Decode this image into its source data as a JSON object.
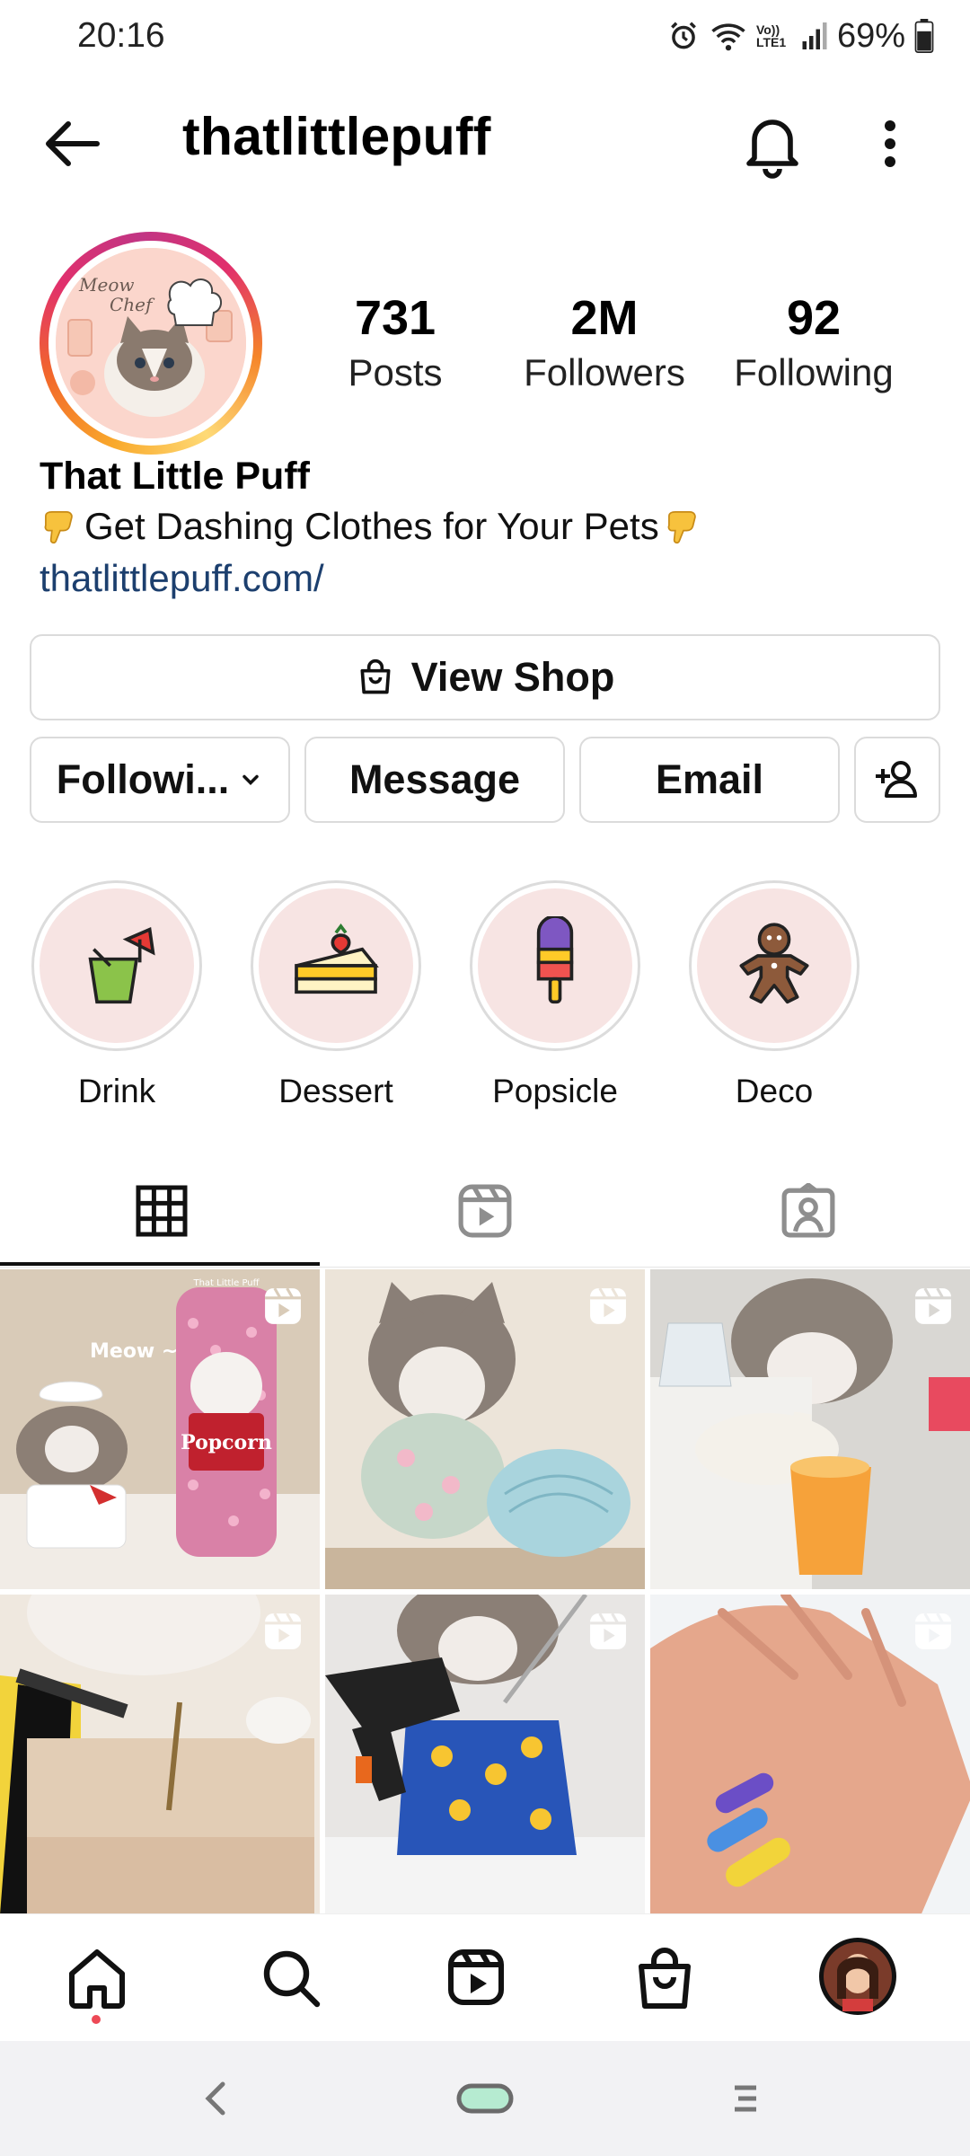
{
  "status": {
    "time": "20:16",
    "battery": "69%",
    "network_badge": "Vo)) LTE1"
  },
  "header": {
    "username": "thatlittlepuff"
  },
  "profile": {
    "avatar_text": "Meow Chef",
    "stats": [
      {
        "num": "731",
        "label": "Posts"
      },
      {
        "num": "2M",
        "label": "Followers"
      },
      {
        "num": "92",
        "label": "Following"
      }
    ],
    "display_name": "That Little Puff",
    "bio": "Get Dashing Clothes for Your Pets",
    "link": "thatlittlepuff.com/"
  },
  "buttons": {
    "view_shop": "View Shop",
    "following": "Followi...",
    "message": "Message",
    "email": "Email"
  },
  "highlights": [
    {
      "label": "Drink",
      "icon": "drink-icon"
    },
    {
      "label": "Dessert",
      "icon": "cake-icon"
    },
    {
      "label": "Popsicle",
      "icon": "popsicle-icon"
    },
    {
      "label": "Deco",
      "icon": "gingerbread-icon"
    }
  ],
  "tabs": [
    {
      "name": "grid-icon",
      "active": true
    },
    {
      "name": "reels-icon",
      "active": false
    },
    {
      "name": "tagged-icon",
      "active": false
    }
  ],
  "posts": [
    {
      "caption_text": "Meow ~",
      "product_label": "Popcorn",
      "brand_label": "That Little Puff",
      "type": "reel"
    },
    {
      "type": "reel"
    },
    {
      "type": "reel"
    },
    {
      "type": "reel"
    },
    {
      "type": "reel"
    },
    {
      "type": "reel"
    }
  ],
  "colors": {
    "link": "#1c3f6e",
    "accent_red": "#ed4956",
    "border": "#dbdbdb"
  }
}
